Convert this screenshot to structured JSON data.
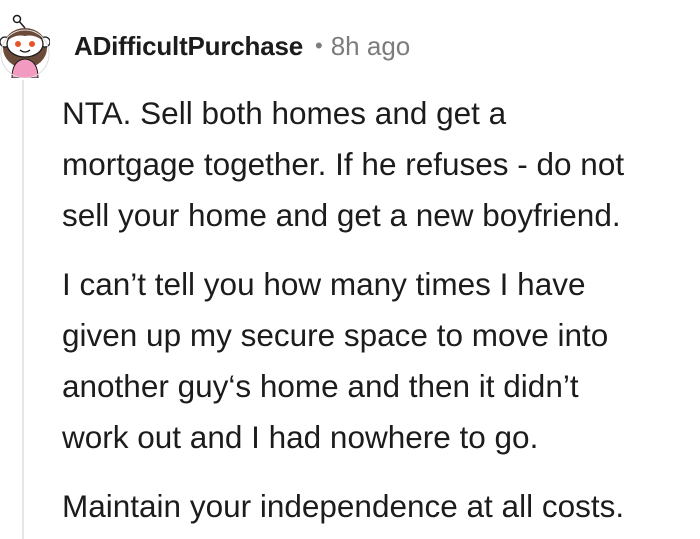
{
  "comment": {
    "username": "ADifficultPurchase",
    "separator": "•",
    "timestamp": "8h ago",
    "avatar_icon": "snoo-avatar-icon",
    "paragraphs": [
      [
        "NTA. Sell both homes and get a",
        "mortgage together. If he refuses - do not",
        "sell your home and get a new boyfriend."
      ],
      [
        "I can’t tell you how many times I have",
        "given up my secure space to move into",
        "another guy‘s home and then it didn’t",
        "work out and I had nowhere to go."
      ],
      [
        "Maintain your independence at all costs."
      ]
    ]
  },
  "colors": {
    "text": "#1c1c1c",
    "meta": "#7c7c7c",
    "thread_line": "#e6e6e6",
    "avatar_hair": "#6b4a3a",
    "avatar_shirt": "#f39ac0"
  }
}
